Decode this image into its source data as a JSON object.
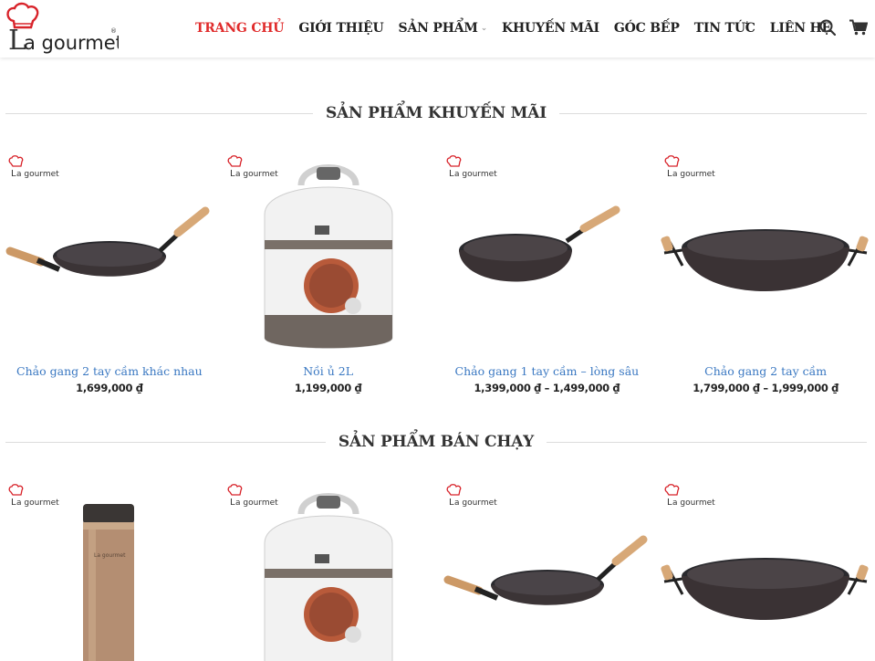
{
  "brand": {
    "logo_text": "a gourmet",
    "logo_letter": "L",
    "registered": "®"
  },
  "nav": {
    "items": [
      {
        "label": "TRANG CHỦ",
        "active": true
      },
      {
        "label": "GIỚI THIỆU",
        "active": false
      },
      {
        "label": "SẢN PHẨM",
        "active": false,
        "has_dropdown": true
      },
      {
        "label": "KHUYẾN MÃI",
        "active": false
      },
      {
        "label": "GÓC BẾP",
        "active": false
      },
      {
        "label": "TIN TỨC",
        "active": false
      },
      {
        "label": "LIÊN HỆ",
        "active": false
      }
    ],
    "icons": [
      "search-icon",
      "cart-icon"
    ]
  },
  "sections": {
    "promo": {
      "title": "SẢN PHẨM KHUYẾN MÃI",
      "products": [
        {
          "name": "Chảo gang 2 tay cầm khác nhau",
          "price": "1,699,000 ₫",
          "image": "wok-two-handles-icon"
        },
        {
          "name": "Nồi ủ 2L",
          "price": "1,199,000 ₫",
          "image": "thermal-cooker-icon"
        },
        {
          "name": "Chảo gang 1 tay cầm – lòng sâu",
          "price": "1,399,000 ₫ – 1,499,000 ₫",
          "image": "deep-pan-icon"
        },
        {
          "name": "Chảo gang 2 tay cầm",
          "price": "1,799,000 ₫ – 1,999,000 ₫",
          "image": "wok-twin-loops-icon"
        }
      ]
    },
    "bestseller": {
      "title": "SẢN PHẨM BÁN CHẠY",
      "products": [
        {
          "image": "thermos-bottle-icon"
        },
        {
          "image": "thermal-cooker-icon"
        },
        {
          "image": "wok-two-handles-icon"
        },
        {
          "image": "wok-twin-loops-icon"
        }
      ]
    }
  },
  "colors": {
    "accent": "#e02b2b",
    "link": "#3a78c2",
    "text": "#222222",
    "divider": "#dcdcdc"
  }
}
